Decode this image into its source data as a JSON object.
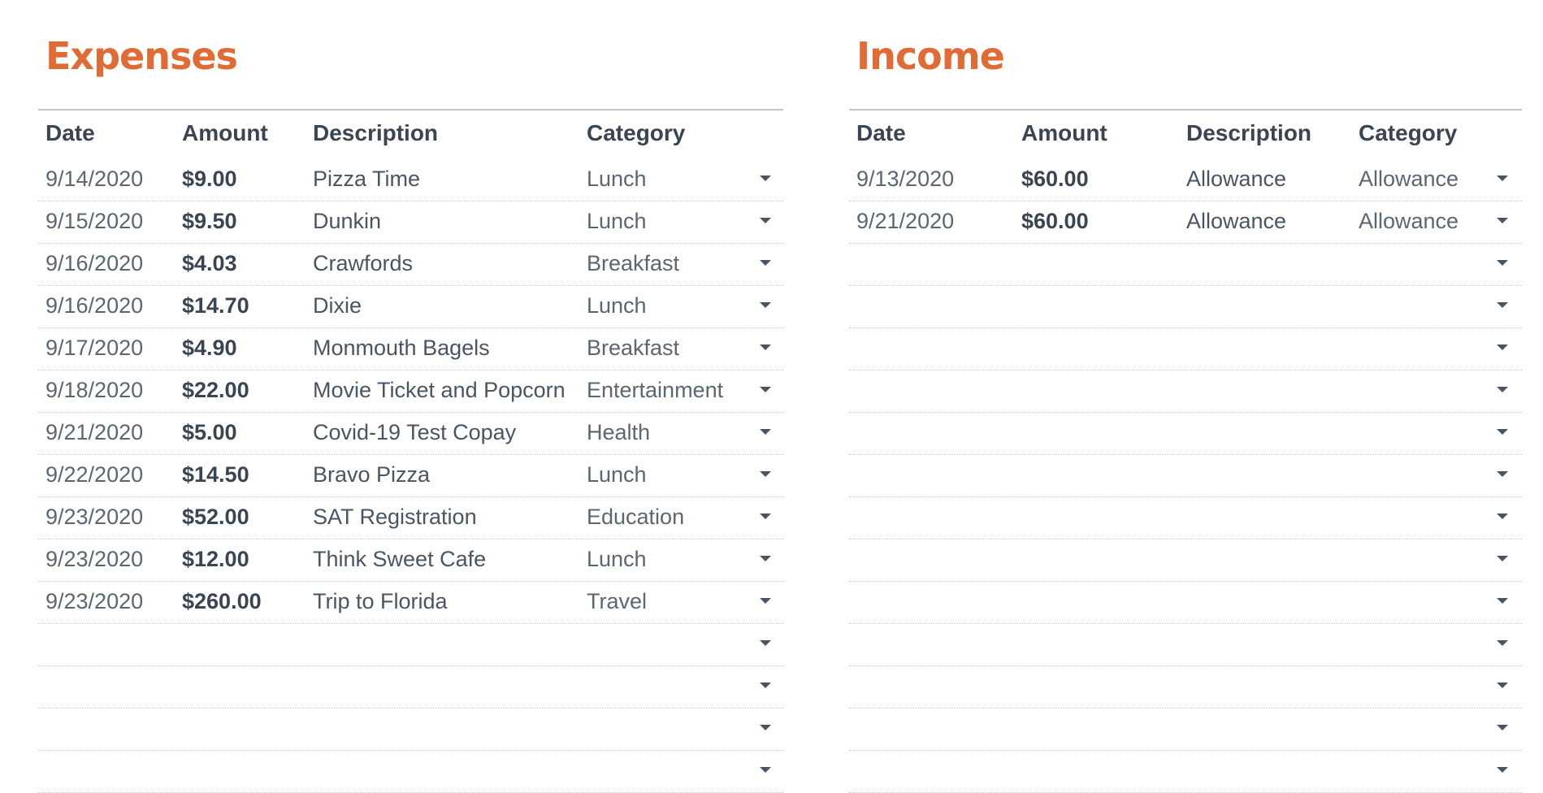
{
  "colors": {
    "title": "#e06b35",
    "header_text": "#3a4553",
    "cell_text": "#5b6673",
    "rule": "#c3c7cc",
    "dotted_rule": "#c4c9cf"
  },
  "icons": {
    "dropdown": "chevron-down-icon"
  },
  "expenses": {
    "title": "Expenses",
    "headers": {
      "date": "Date",
      "amount": "Amount",
      "description": "Description",
      "category": "Category"
    },
    "rows": [
      {
        "date": "9/14/2020",
        "amount": "$9.00",
        "description": "Pizza Time",
        "category": "Lunch"
      },
      {
        "date": "9/15/2020",
        "amount": "$9.50",
        "description": "Dunkin",
        "category": "Lunch"
      },
      {
        "date": "9/16/2020",
        "amount": "$4.03",
        "description": "Crawfords",
        "category": "Breakfast"
      },
      {
        "date": "9/16/2020",
        "amount": "$14.70",
        "description": "Dixie",
        "category": "Lunch"
      },
      {
        "date": "9/17/2020",
        "amount": "$4.90",
        "description": "Monmouth Bagels",
        "category": "Breakfast"
      },
      {
        "date": "9/18/2020",
        "amount": "$22.00",
        "description": "Movie Ticket and Popcorn",
        "category": "Entertainment"
      },
      {
        "date": "9/21/2020",
        "amount": "$5.00",
        "description": "Covid-19 Test Copay",
        "category": "Health"
      },
      {
        "date": "9/22/2020",
        "amount": "$14.50",
        "description": "Bravo Pizza",
        "category": "Lunch"
      },
      {
        "date": "9/23/2020",
        "amount": "$52.00",
        "description": "SAT Registration",
        "category": "Education"
      },
      {
        "date": "9/23/2020",
        "amount": "$12.00",
        "description": "Think Sweet Cafe",
        "category": "Lunch"
      },
      {
        "date": "9/23/2020",
        "amount": "$260.00",
        "description": "Trip to Florida",
        "category": "Travel"
      },
      {
        "date": "",
        "amount": "",
        "description": "",
        "category": ""
      },
      {
        "date": "",
        "amount": "",
        "description": "",
        "category": ""
      },
      {
        "date": "",
        "amount": "",
        "description": "",
        "category": ""
      },
      {
        "date": "",
        "amount": "",
        "description": "",
        "category": ""
      }
    ]
  },
  "income": {
    "title": "Income",
    "headers": {
      "date": "Date",
      "amount": "Amount",
      "description": "Description",
      "category": "Category"
    },
    "rows": [
      {
        "date": "9/13/2020",
        "amount": "$60.00",
        "description": "Allowance",
        "category": "Allowance"
      },
      {
        "date": "9/21/2020",
        "amount": "$60.00",
        "description": "Allowance",
        "category": "Allowance"
      },
      {
        "date": "",
        "amount": "",
        "description": "",
        "category": ""
      },
      {
        "date": "",
        "amount": "",
        "description": "",
        "category": ""
      },
      {
        "date": "",
        "amount": "",
        "description": "",
        "category": ""
      },
      {
        "date": "",
        "amount": "",
        "description": "",
        "category": ""
      },
      {
        "date": "",
        "amount": "",
        "description": "",
        "category": ""
      },
      {
        "date": "",
        "amount": "",
        "description": "",
        "category": ""
      },
      {
        "date": "",
        "amount": "",
        "description": "",
        "category": ""
      },
      {
        "date": "",
        "amount": "",
        "description": "",
        "category": ""
      },
      {
        "date": "",
        "amount": "",
        "description": "",
        "category": ""
      },
      {
        "date": "",
        "amount": "",
        "description": "",
        "category": ""
      },
      {
        "date": "",
        "amount": "",
        "description": "",
        "category": ""
      },
      {
        "date": "",
        "amount": "",
        "description": "",
        "category": ""
      },
      {
        "date": "",
        "amount": "",
        "description": "",
        "category": ""
      }
    ]
  }
}
